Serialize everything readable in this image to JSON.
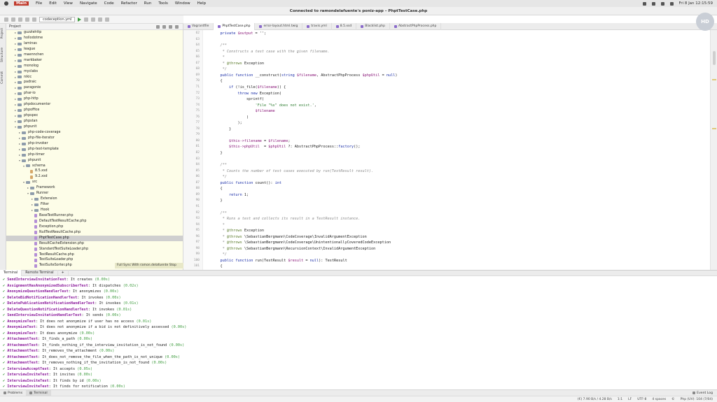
{
  "menubar": {
    "app_name": "Main",
    "items": [
      "File",
      "Edit",
      "View",
      "Navigate",
      "Code",
      "Refactor",
      "Run",
      "Tools",
      "Window",
      "Help"
    ],
    "datetime": "Fri 8 Jan  12:15:59"
  },
  "window": {
    "title": "Connected to ramondelafuente's poniz-app – PhptTestCase.php"
  },
  "toolbar": {
    "run_config": "codeception.yml"
  },
  "editor_tabs": [
    {
      "label": "Vagrantfile",
      "active": false
    },
    {
      "label": "PhptTestCase.php",
      "active": true
    },
    {
      "label": "error-layout.html.twig",
      "active": false
    },
    {
      "label": "travis.yml",
      "active": false
    },
    {
      "label": "8.5.xsd",
      "active": false
    },
    {
      "label": "Blacklist.php",
      "active": false
    },
    {
      "label": "AbstractPhpProcess.php",
      "active": false
    }
  ],
  "side_strip": {
    "project": "Project",
    "structure": "Structure",
    "commit": "Commit"
  },
  "project_panel": {
    "header": "Project",
    "tree": [
      {
        "label": "guzzlehttp",
        "depth": 1,
        "kind": "folder",
        "expanded": false
      },
      {
        "label": "hollodotme",
        "depth": 1,
        "kind": "folder",
        "expanded": false
      },
      {
        "label": "laminas",
        "depth": 1,
        "kind": "folder",
        "expanded": false
      },
      {
        "label": "league",
        "depth": 1,
        "kind": "folder",
        "expanded": false
      },
      {
        "label": "maennchen",
        "depth": 1,
        "kind": "folder",
        "expanded": false
      },
      {
        "label": "markbaker",
        "depth": 1,
        "kind": "folder",
        "expanded": false
      },
      {
        "label": "monolog",
        "depth": 1,
        "kind": "folder",
        "expanded": false
      },
      {
        "label": "myclabs",
        "depth": 1,
        "kind": "folder",
        "expanded": false
      },
      {
        "label": "nikic",
        "depth": 1,
        "kind": "folder",
        "expanded": false
      },
      {
        "label": "padraic",
        "depth": 1,
        "kind": "folder",
        "expanded": false
      },
      {
        "label": "paragonie",
        "depth": 1,
        "kind": "folder",
        "expanded": false
      },
      {
        "label": "phar-io",
        "depth": 1,
        "kind": "folder",
        "expanded": false
      },
      {
        "label": "php-http",
        "depth": 1,
        "kind": "folder",
        "expanded": false
      },
      {
        "label": "phpdocumentor",
        "depth": 1,
        "kind": "folder",
        "expanded": false
      },
      {
        "label": "phpoffice",
        "depth": 1,
        "kind": "folder",
        "expanded": false
      },
      {
        "label": "phpspec",
        "depth": 1,
        "kind": "folder",
        "expanded": false
      },
      {
        "label": "phpstan",
        "depth": 1,
        "kind": "folder",
        "expanded": false
      },
      {
        "label": "phpunit",
        "depth": 1,
        "kind": "folder",
        "expanded": true
      },
      {
        "label": "php-code-coverage",
        "depth": 2,
        "kind": "folder",
        "expanded": false
      },
      {
        "label": "php-file-iterator",
        "depth": 2,
        "kind": "folder",
        "expanded": false
      },
      {
        "label": "php-invoker",
        "depth": 2,
        "kind": "folder",
        "expanded": false
      },
      {
        "label": "php-text-template",
        "depth": 2,
        "kind": "folder",
        "expanded": false
      },
      {
        "label": "php-timer",
        "depth": 2,
        "kind": "folder",
        "expanded": false
      },
      {
        "label": "phpunit",
        "depth": 2,
        "kind": "folder",
        "expanded": true
      },
      {
        "label": "schema",
        "depth": 3,
        "kind": "folder",
        "expanded": true
      },
      {
        "label": "8.5.xsd",
        "depth": 4,
        "kind": "xsd",
        "expanded": false
      },
      {
        "label": "9.2.xsd",
        "depth": 4,
        "kind": "xsd",
        "expanded": false
      },
      {
        "label": "src",
        "depth": 3,
        "kind": "folder",
        "expanded": true
      },
      {
        "label": "Framework",
        "depth": 4,
        "kind": "folder",
        "expanded": false
      },
      {
        "label": "Runner",
        "depth": 4,
        "kind": "folder",
        "expanded": true
      },
      {
        "label": "Extension",
        "depth": 5,
        "kind": "folder",
        "expanded": false
      },
      {
        "label": "Filter",
        "depth": 5,
        "kind": "folder",
        "expanded": false
      },
      {
        "label": "Hook",
        "depth": 5,
        "kind": "folder",
        "expanded": false
      },
      {
        "label": "BaseTestRunner.php",
        "depth": 5,
        "kind": "php",
        "expanded": false
      },
      {
        "label": "DefaultTestResultCache.php",
        "depth": 5,
        "kind": "php",
        "expanded": false
      },
      {
        "label": "Exception.php",
        "depth": 5,
        "kind": "php",
        "expanded": false
      },
      {
        "label": "NullTestResultCache.php",
        "depth": 5,
        "kind": "php",
        "expanded": false
      },
      {
        "label": "PhptTestCase.php",
        "depth": 5,
        "kind": "php",
        "expanded": false,
        "selected": true
      },
      {
        "label": "ResultCacheExtension.php",
        "depth": 5,
        "kind": "php",
        "expanded": false
      },
      {
        "label": "StandardTestSuiteLoader.php",
        "depth": 5,
        "kind": "php",
        "expanded": false
      },
      {
        "label": "TestResultCache.php",
        "depth": 5,
        "kind": "php",
        "expanded": false
      },
      {
        "label": "TestSuiteLoader.php",
        "depth": 5,
        "kind": "php",
        "expanded": false
      },
      {
        "label": "TestSuiteSorter.php",
        "depth": 5,
        "kind": "php",
        "expanded": false
      }
    ],
    "sync_text": "Full Sync With ramon.delafuente  Stop"
  },
  "editor": {
    "lines": [
      {
        "n": "62",
        "tokens": [
          [
            "",
            "    "
          ],
          [
            "kw",
            "private"
          ],
          [
            "",
            " "
          ],
          [
            "vr",
            "$output"
          ],
          [
            "",
            " = '';"
          ]
        ]
      },
      {
        "n": "63",
        "tokens": []
      },
      {
        "n": "64",
        "tokens": [
          [
            "cm",
            "    /**"
          ]
        ]
      },
      {
        "n": "65",
        "tokens": [
          [
            "cm",
            "     * Constructs a test case with the given filename."
          ]
        ]
      },
      {
        "n": "66",
        "tokens": [
          [
            "cm",
            "     *"
          ]
        ]
      },
      {
        "n": "67",
        "tokens": [
          [
            "cm",
            "     * "
          ],
          [
            "tg",
            "@throws"
          ],
          [
            "",
            " Exception"
          ]
        ]
      },
      {
        "n": "68",
        "tokens": [
          [
            "cm",
            "     */"
          ]
        ]
      },
      {
        "n": "69",
        "tokens": [
          [
            "",
            "    "
          ],
          [
            "kw",
            "public function"
          ],
          [
            "",
            " __construct("
          ],
          [
            "kw",
            "string"
          ],
          [
            "",
            " "
          ],
          [
            "vr",
            "$filename"
          ],
          [
            "",
            ", AbstractPhpProcess "
          ],
          [
            "vr",
            "$phpUtil"
          ],
          [
            "",
            " = "
          ],
          [
            "kw",
            "null"
          ],
          [
            "",
            ")"
          ]
        ]
      },
      {
        "n": "70",
        "tokens": [
          [
            "",
            "    {"
          ]
        ]
      },
      {
        "n": "71",
        "tokens": [
          [
            "",
            "        "
          ],
          [
            "kw",
            "if"
          ],
          [
            "",
            " (!is_file("
          ],
          [
            "vr",
            "$filename"
          ],
          [
            "",
            ")) {"
          ]
        ]
      },
      {
        "n": "72",
        "tokens": [
          [
            "",
            "            "
          ],
          [
            "kw",
            "throw new"
          ],
          [
            "",
            " Exception("
          ]
        ]
      },
      {
        "n": "73",
        "tokens": [
          [
            "",
            "                sprintf("
          ]
        ]
      },
      {
        "n": "74",
        "tokens": [
          [
            "",
            "                    "
          ],
          [
            "st",
            "'File \"%s\" does not exist.'"
          ],
          [
            "",
            ","
          ]
        ]
      },
      {
        "n": "75",
        "tokens": [
          [
            "",
            "                    "
          ],
          [
            "vr",
            "$filename"
          ]
        ]
      },
      {
        "n": "76",
        "tokens": [
          [
            "",
            "                )"
          ]
        ]
      },
      {
        "n": "77",
        "tokens": [
          [
            "",
            "            );"
          ]
        ]
      },
      {
        "n": "78",
        "tokens": [
          [
            "",
            "        }"
          ]
        ]
      },
      {
        "n": "79",
        "tokens": []
      },
      {
        "n": "80",
        "tokens": [
          [
            "",
            "        "
          ],
          [
            "vr",
            "$this->filename"
          ],
          [
            "",
            " = "
          ],
          [
            "vr",
            "$filename"
          ],
          [
            "",
            ";"
          ]
        ]
      },
      {
        "n": "81",
        "tokens": [
          [
            "",
            "        "
          ],
          [
            "vr",
            "$this->phpUtil"
          ],
          [
            "",
            "  = "
          ],
          [
            "vr",
            "$phpUtil"
          ],
          [
            "",
            " ?: AbstractPhpProcess::"
          ],
          [
            "kw",
            "factory"
          ],
          [
            "",
            "();"
          ]
        ]
      },
      {
        "n": "82",
        "tokens": [
          [
            "",
            "    }"
          ]
        ]
      },
      {
        "n": "83",
        "tokens": []
      },
      {
        "n": "84",
        "tokens": [
          [
            "cm",
            "    /**"
          ]
        ]
      },
      {
        "n": "85",
        "tokens": [
          [
            "cm",
            "     * Counts the number of test cases executed by run(TestResult result)."
          ]
        ]
      },
      {
        "n": "86",
        "tokens": [
          [
            "cm",
            "     */"
          ]
        ]
      },
      {
        "n": "87",
        "tokens": [
          [
            "",
            "    "
          ],
          [
            "kw",
            "public function"
          ],
          [
            "",
            " count(): "
          ],
          [
            "kw",
            "int"
          ]
        ]
      },
      {
        "n": "88",
        "tokens": [
          [
            "",
            "    {"
          ]
        ]
      },
      {
        "n": "89",
        "tokens": [
          [
            "",
            "        "
          ],
          [
            "kw",
            "return"
          ],
          [
            "",
            " 1;"
          ]
        ]
      },
      {
        "n": "90",
        "tokens": [
          [
            "",
            "    }"
          ]
        ]
      },
      {
        "n": "91",
        "tokens": []
      },
      {
        "n": "92",
        "tokens": [
          [
            "cm",
            "    /**"
          ]
        ]
      },
      {
        "n": "93",
        "tokens": [
          [
            "cm",
            "     * Runs a test and collects its result in a TestResult instance."
          ]
        ]
      },
      {
        "n": "94",
        "tokens": [
          [
            "cm",
            "     *"
          ]
        ]
      },
      {
        "n": "95",
        "tokens": [
          [
            "cm",
            "     * "
          ],
          [
            "tg",
            "@throws"
          ],
          [
            "",
            " Exception"
          ]
        ]
      },
      {
        "n": "96",
        "tokens": [
          [
            "cm",
            "     * "
          ],
          [
            "tg",
            "@throws"
          ],
          [
            "",
            " \\SebastianBergmann\\CodeCoverage\\InvalidArgumentException"
          ]
        ]
      },
      {
        "n": "97",
        "tokens": [
          [
            "cm",
            "     * "
          ],
          [
            "tg",
            "@throws"
          ],
          [
            "",
            " \\SebastianBergmann\\CodeCoverage\\UnintentionallyCoveredCodeException"
          ]
        ]
      },
      {
        "n": "98",
        "tokens": [
          [
            "cm",
            "     * "
          ],
          [
            "tg",
            "@throws"
          ],
          [
            "",
            " \\SebastianBergmann\\RecursionContext\\InvalidArgumentException"
          ]
        ]
      },
      {
        "n": "99",
        "tokens": [
          [
            "cm",
            "     */"
          ]
        ]
      },
      {
        "n": "100",
        "tokens": [
          [
            "",
            "    "
          ],
          [
            "kw",
            "public function"
          ],
          [
            "",
            " run(TestResult "
          ],
          [
            "vr",
            "$result"
          ],
          [
            "",
            " = "
          ],
          [
            "kw",
            "null"
          ],
          [
            "",
            "): TestResult"
          ]
        ]
      },
      {
        "n": "101",
        "tokens": [
          [
            "",
            "    {"
          ]
        ]
      }
    ]
  },
  "terminal_tabs": [
    "Terminal",
    "Remote Terminal",
    "+"
  ],
  "terminal": {
    "lines": [
      {
        "name": "SendInterviewInvitationTest",
        "desc": "It creates",
        "time": "(0.00s)"
      },
      {
        "name": "AssignmentHasAnonymizedSubscriberTest",
        "desc": "It dispatches",
        "time": "(0.02s)"
      },
      {
        "name": "AnonymizeQuestionHandlerTest",
        "desc": "It anonymizes",
        "time": "(0.00s)"
      },
      {
        "name": "DeleteBidNotificationHandlerTest",
        "desc": "It invokes",
        "time": "(0.00s)"
      },
      {
        "name": "DeletePublicationNotificationHandlerTest",
        "desc": "It invokes",
        "time": "(0.01s)"
      },
      {
        "name": "DeleteQuestionNotificationHandlerTest",
        "desc": "It invokes",
        "time": "(0.01s)"
      },
      {
        "name": "SendInterviewInvitationHandlerTest",
        "desc": "It sends",
        "time": "(0.00s)"
      },
      {
        "name": "AnonymizeTest",
        "desc": "It does not anonymize if user has no access",
        "time": "(0.01s)"
      },
      {
        "name": "AnonymizeTest",
        "desc": "It does not anonymize if a bid is not definitively assessed",
        "time": "(0.00s)"
      },
      {
        "name": "AnonymizeTest",
        "desc": "It does anonymize",
        "time": "(0.00s)"
      },
      {
        "name": "AttachmentTest",
        "desc": "It_finds_a_path",
        "time": "(0.00s)"
      },
      {
        "name": "AttachmentTest",
        "desc": "It_finds_nothing_if_the_interview_invitation_is_not_found",
        "time": "(0.00s)"
      },
      {
        "name": "AttachmentTest",
        "desc": "It_removes_the_attachment",
        "time": "(0.00s)"
      },
      {
        "name": "AttachmentTest",
        "desc": "It_does_not_remove_the_file_when_the_path_is_not_unique",
        "time": "(0.00s)"
      },
      {
        "name": "AttachmentTest",
        "desc": "It_removes_nothing_if_the_invitation_is_not_found",
        "time": "(0.00s)"
      },
      {
        "name": "InterviewAcceptTest",
        "desc": "It accepts",
        "time": "(0.05s)"
      },
      {
        "name": "InterviewInviteTest",
        "desc": "It invites",
        "time": "(0.00s)"
      },
      {
        "name": "InterviewInviteTest",
        "desc": "It finds by id",
        "time": "(0.00s)"
      },
      {
        "name": "InterviewInviteTest",
        "desc": "It finds for notification",
        "time": "(0.00s)"
      }
    ]
  },
  "bottom_tabs": {
    "problems": "Problems",
    "terminal": "Terminal",
    "event_log": "Event Log"
  },
  "statusbar": {
    "items": [
      "(€) 7.90 B/s / 4.28 B/s",
      "1:1",
      "LF",
      "UTF-8",
      "4 spaces",
      "©",
      "Php (UV): 104 (7/04)"
    ]
  },
  "avatar": {
    "initials": "HD"
  },
  "colors": {
    "app_accent": "#c0392b",
    "project_bg": "#fdfde8",
    "test_name": "#8b1a9b",
    "pass": "#3c9a3c"
  }
}
